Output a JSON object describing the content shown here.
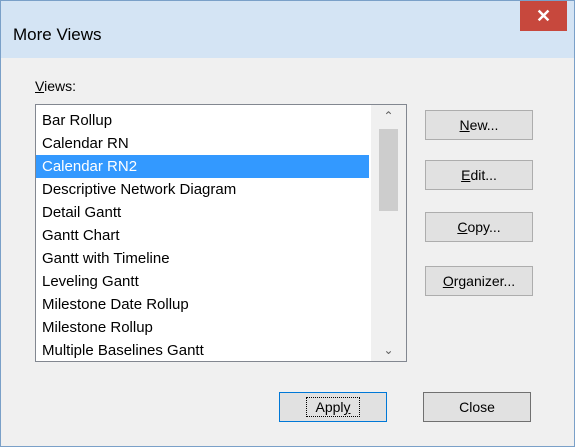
{
  "window": {
    "title": "More Views",
    "close_glyph": "✕"
  },
  "views_label": "Views:",
  "views_list": {
    "items": [
      "Bar Rollup",
      "Calendar RN",
      "Calendar RN2",
      "Descriptive Network Diagram",
      "Detail Gantt",
      "Gantt Chart",
      "Gantt with Timeline",
      "Leveling Gantt",
      "Milestone Date Rollup",
      "Milestone Rollup",
      "Multiple Baselines Gantt"
    ],
    "selected": "Calendar RN2"
  },
  "scrollbar": {
    "up_icon": "chevron-up-icon",
    "down_icon": "chevron-down-icon"
  },
  "buttons": {
    "new": {
      "accel": "N",
      "rest": "ew..."
    },
    "edit": {
      "accel": "E",
      "rest": "dit..."
    },
    "copy": {
      "accel": "C",
      "rest": "opy..."
    },
    "organizer": {
      "accel": "O",
      "rest": "rganizer..."
    },
    "apply": {
      "pre": "Appl",
      "accel": "y"
    },
    "close": "Close"
  },
  "colors": {
    "selection": "#3399ff",
    "close_button": "#c7483d",
    "titlebar": "#d4e4f4"
  }
}
